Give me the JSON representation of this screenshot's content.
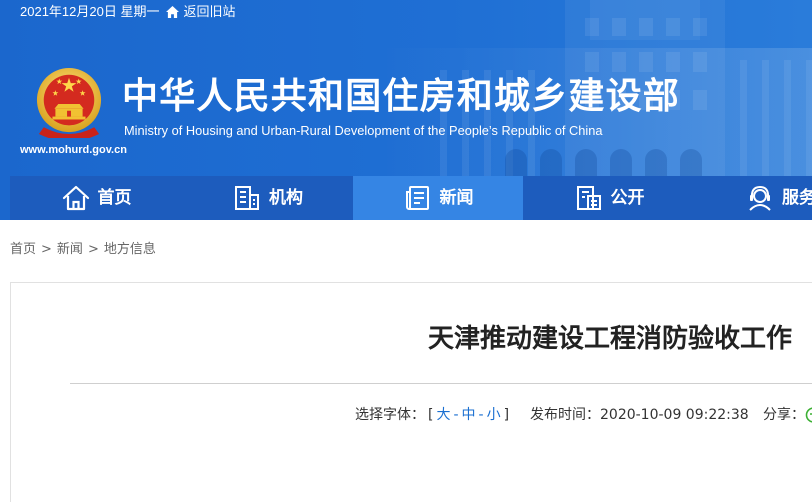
{
  "topbar": {
    "date": "2021年12月20日 星期一",
    "home_icon": "home-icon",
    "old_site_label": "返回旧站"
  },
  "header": {
    "emblem": "national-emblem-icon",
    "title": "中华人民共和国住房和城乡建设部",
    "subtitle": "Ministry of Housing and Urban-Rural Development of the People’s Republic of China",
    "url": "www.mohurd.gov.cn"
  },
  "nav": {
    "items": [
      {
        "label": "首页",
        "icon": "home-icon",
        "active": false
      },
      {
        "label": "机构",
        "icon": "building-icon",
        "active": false
      },
      {
        "label": "新闻",
        "icon": "news-document-icon",
        "active": true
      },
      {
        "label": "公开",
        "icon": "disclosure-icon",
        "active": false
      },
      {
        "label": "服务",
        "icon": "service-headset-icon",
        "active": false
      }
    ]
  },
  "breadcrumb": {
    "items": [
      "首页",
      "新闻",
      "地方信息"
    ],
    "separator": ">"
  },
  "article": {
    "title": "天津推动建设工程消防验收工作",
    "font_size_label": "选择字体：",
    "bracket_open": "[",
    "font_sizes": [
      "大",
      "中",
      "小"
    ],
    "font_size_separator": "-",
    "bracket_close": "]",
    "publish_label": "发布时间：",
    "publish_time": "2020-10-09 09:22:38",
    "share_label": "分享：",
    "share_icon": "wechat-icon"
  },
  "colors": {
    "header": "#1b67cd",
    "nav": "#1d5cbd",
    "nav_active": "#3585e4",
    "link": "#1a6fd1",
    "wechat": "#3cb034"
  }
}
